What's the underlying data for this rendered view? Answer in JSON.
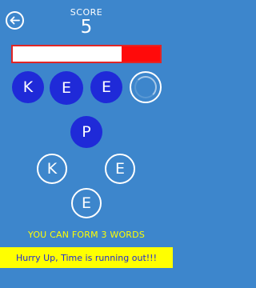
{
  "header": {
    "back_icon": "back-arrow-icon",
    "score_label": "SCORE",
    "score_value": "5"
  },
  "timer": {
    "remaining_fraction": 0.26,
    "fill_color": "#ff0a0a"
  },
  "answer_slots": [
    {
      "letter": "K",
      "state": "filled"
    },
    {
      "letter": "E",
      "state": "filled"
    },
    {
      "letter": "E",
      "state": "filled"
    },
    {
      "letter": "",
      "state": "empty"
    }
  ],
  "letter_choices": [
    {
      "letter": "P",
      "state": "available"
    },
    {
      "letter": "K",
      "state": "used"
    },
    {
      "letter": "E",
      "state": "used"
    },
    {
      "letter": "E",
      "state": "used"
    }
  ],
  "hint_text": "YOU CAN FORM 3 WORDS",
  "banner_text": "Hurry Up, Time is running out!!!",
  "colors": {
    "background": "#3d86cc",
    "tile_blue": "#1f2ad8",
    "hint_yellow": "#ffff00",
    "timer_red": "#ff0a0a"
  }
}
